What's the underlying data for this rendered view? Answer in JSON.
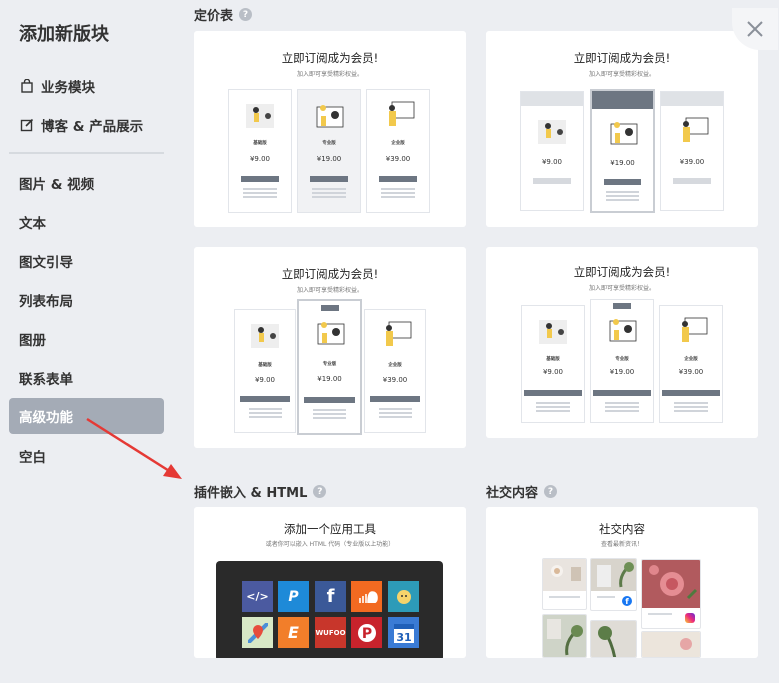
{
  "sidebar": {
    "title": "添加新版块",
    "items": [
      {
        "label": "业务模块"
      },
      {
        "label": "博客 & 产品展示"
      },
      {
        "label": "图片 & 视频"
      },
      {
        "label": "文本"
      },
      {
        "label": "图文引导"
      },
      {
        "label": "列表布局"
      },
      {
        "label": "图册"
      },
      {
        "label": "联系表单"
      },
      {
        "label": "高级功能"
      },
      {
        "label": "空白"
      }
    ]
  },
  "sections": {
    "pricing": {
      "title": "定价表",
      "card_title": "立即订阅成为会员!",
      "card_sub": "加入即可享受精彩权益。",
      "plans": [
        {
          "name": "基础版",
          "price": "¥9.00"
        },
        {
          "name": "专业版",
          "price": "¥19.00"
        },
        {
          "name": "企业版",
          "price": "¥39.00"
        }
      ]
    },
    "embed": {
      "title": "插件嵌入 & HTML",
      "card_title": "添加一个应用工具",
      "card_sub": "或者你可以嵌入 HTML 代码（专业版以上功能）"
    },
    "social": {
      "title": "社交内容",
      "card_title": "社交内容",
      "card_sub": "查看最新资讯！"
    }
  },
  "colors": {
    "active_bg": "#a4abb6",
    "arrow": "#e53935",
    "tool_panel": "#2a2a2a"
  }
}
